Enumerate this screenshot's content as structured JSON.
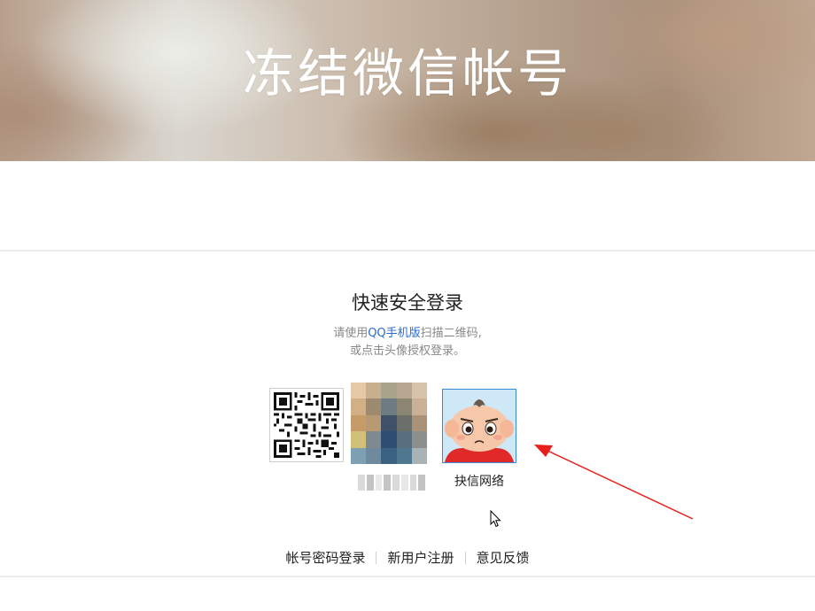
{
  "hero": {
    "title": "冻结微信帐号"
  },
  "login": {
    "title": "快速安全登录",
    "desc_prefix": "请使用",
    "desc_link": "QQ手机版",
    "desc_suffix": "扫描二维码,",
    "desc_line2": "或点击头像授权登录。",
    "qr_icon": "qr-code-icon",
    "accounts": [
      {
        "avatar_icon": "blurred-avatar-image",
        "name": ""
      },
      {
        "avatar_icon": "cartoon-avatar-image",
        "name": "抉信网络"
      }
    ]
  },
  "footer": {
    "links": [
      "帐号密码登录",
      "新用户注册",
      "意见反馈"
    ]
  },
  "colors": {
    "link": "#2b6bd1",
    "annotation_arrow": "#e8201c",
    "avatar_border": "#3a8ad8"
  }
}
